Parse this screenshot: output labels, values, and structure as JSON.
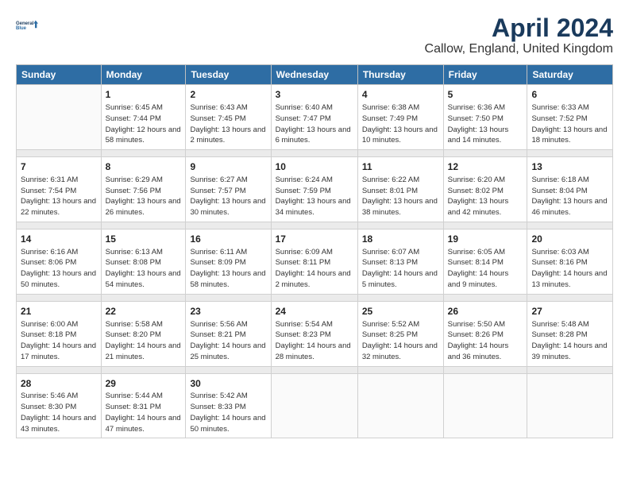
{
  "header": {
    "logo_line1": "General",
    "logo_line2": "Blue",
    "title": "April 2024",
    "subtitle": "Callow, England, United Kingdom"
  },
  "calendar": {
    "days": [
      "Sunday",
      "Monday",
      "Tuesday",
      "Wednesday",
      "Thursday",
      "Friday",
      "Saturday"
    ],
    "weeks": [
      [
        {
          "day": "",
          "sunrise": "",
          "sunset": "",
          "daylight": ""
        },
        {
          "day": "1",
          "sunrise": "Sunrise: 6:45 AM",
          "sunset": "Sunset: 7:44 PM",
          "daylight": "Daylight: 12 hours and 58 minutes."
        },
        {
          "day": "2",
          "sunrise": "Sunrise: 6:43 AM",
          "sunset": "Sunset: 7:45 PM",
          "daylight": "Daylight: 13 hours and 2 minutes."
        },
        {
          "day": "3",
          "sunrise": "Sunrise: 6:40 AM",
          "sunset": "Sunset: 7:47 PM",
          "daylight": "Daylight: 13 hours and 6 minutes."
        },
        {
          "day": "4",
          "sunrise": "Sunrise: 6:38 AM",
          "sunset": "Sunset: 7:49 PM",
          "daylight": "Daylight: 13 hours and 10 minutes."
        },
        {
          "day": "5",
          "sunrise": "Sunrise: 6:36 AM",
          "sunset": "Sunset: 7:50 PM",
          "daylight": "Daylight: 13 hours and 14 minutes."
        },
        {
          "day": "6",
          "sunrise": "Sunrise: 6:33 AM",
          "sunset": "Sunset: 7:52 PM",
          "daylight": "Daylight: 13 hours and 18 minutes."
        }
      ],
      [
        {
          "day": "7",
          "sunrise": "Sunrise: 6:31 AM",
          "sunset": "Sunset: 7:54 PM",
          "daylight": "Daylight: 13 hours and 22 minutes."
        },
        {
          "day": "8",
          "sunrise": "Sunrise: 6:29 AM",
          "sunset": "Sunset: 7:56 PM",
          "daylight": "Daylight: 13 hours and 26 minutes."
        },
        {
          "day": "9",
          "sunrise": "Sunrise: 6:27 AM",
          "sunset": "Sunset: 7:57 PM",
          "daylight": "Daylight: 13 hours and 30 minutes."
        },
        {
          "day": "10",
          "sunrise": "Sunrise: 6:24 AM",
          "sunset": "Sunset: 7:59 PM",
          "daylight": "Daylight: 13 hours and 34 minutes."
        },
        {
          "day": "11",
          "sunrise": "Sunrise: 6:22 AM",
          "sunset": "Sunset: 8:01 PM",
          "daylight": "Daylight: 13 hours and 38 minutes."
        },
        {
          "day": "12",
          "sunrise": "Sunrise: 6:20 AM",
          "sunset": "Sunset: 8:02 PM",
          "daylight": "Daylight: 13 hours and 42 minutes."
        },
        {
          "day": "13",
          "sunrise": "Sunrise: 6:18 AM",
          "sunset": "Sunset: 8:04 PM",
          "daylight": "Daylight: 13 hours and 46 minutes."
        }
      ],
      [
        {
          "day": "14",
          "sunrise": "Sunrise: 6:16 AM",
          "sunset": "Sunset: 8:06 PM",
          "daylight": "Daylight: 13 hours and 50 minutes."
        },
        {
          "day": "15",
          "sunrise": "Sunrise: 6:13 AM",
          "sunset": "Sunset: 8:08 PM",
          "daylight": "Daylight: 13 hours and 54 minutes."
        },
        {
          "day": "16",
          "sunrise": "Sunrise: 6:11 AM",
          "sunset": "Sunset: 8:09 PM",
          "daylight": "Daylight: 13 hours and 58 minutes."
        },
        {
          "day": "17",
          "sunrise": "Sunrise: 6:09 AM",
          "sunset": "Sunset: 8:11 PM",
          "daylight": "Daylight: 14 hours and 2 minutes."
        },
        {
          "day": "18",
          "sunrise": "Sunrise: 6:07 AM",
          "sunset": "Sunset: 8:13 PM",
          "daylight": "Daylight: 14 hours and 5 minutes."
        },
        {
          "day": "19",
          "sunrise": "Sunrise: 6:05 AM",
          "sunset": "Sunset: 8:14 PM",
          "daylight": "Daylight: 14 hours and 9 minutes."
        },
        {
          "day": "20",
          "sunrise": "Sunrise: 6:03 AM",
          "sunset": "Sunset: 8:16 PM",
          "daylight": "Daylight: 14 hours and 13 minutes."
        }
      ],
      [
        {
          "day": "21",
          "sunrise": "Sunrise: 6:00 AM",
          "sunset": "Sunset: 8:18 PM",
          "daylight": "Daylight: 14 hours and 17 minutes."
        },
        {
          "day": "22",
          "sunrise": "Sunrise: 5:58 AM",
          "sunset": "Sunset: 8:20 PM",
          "daylight": "Daylight: 14 hours and 21 minutes."
        },
        {
          "day": "23",
          "sunrise": "Sunrise: 5:56 AM",
          "sunset": "Sunset: 8:21 PM",
          "daylight": "Daylight: 14 hours and 25 minutes."
        },
        {
          "day": "24",
          "sunrise": "Sunrise: 5:54 AM",
          "sunset": "Sunset: 8:23 PM",
          "daylight": "Daylight: 14 hours and 28 minutes."
        },
        {
          "day": "25",
          "sunrise": "Sunrise: 5:52 AM",
          "sunset": "Sunset: 8:25 PM",
          "daylight": "Daylight: 14 hours and 32 minutes."
        },
        {
          "day": "26",
          "sunrise": "Sunrise: 5:50 AM",
          "sunset": "Sunset: 8:26 PM",
          "daylight": "Daylight: 14 hours and 36 minutes."
        },
        {
          "day": "27",
          "sunrise": "Sunrise: 5:48 AM",
          "sunset": "Sunset: 8:28 PM",
          "daylight": "Daylight: 14 hours and 39 minutes."
        }
      ],
      [
        {
          "day": "28",
          "sunrise": "Sunrise: 5:46 AM",
          "sunset": "Sunset: 8:30 PM",
          "daylight": "Daylight: 14 hours and 43 minutes."
        },
        {
          "day": "29",
          "sunrise": "Sunrise: 5:44 AM",
          "sunset": "Sunset: 8:31 PM",
          "daylight": "Daylight: 14 hours and 47 minutes."
        },
        {
          "day": "30",
          "sunrise": "Sunrise: 5:42 AM",
          "sunset": "Sunset: 8:33 PM",
          "daylight": "Daylight: 14 hours and 50 minutes."
        },
        {
          "day": "",
          "sunrise": "",
          "sunset": "",
          "daylight": ""
        },
        {
          "day": "",
          "sunrise": "",
          "sunset": "",
          "daylight": ""
        },
        {
          "day": "",
          "sunrise": "",
          "sunset": "",
          "daylight": ""
        },
        {
          "day": "",
          "sunrise": "",
          "sunset": "",
          "daylight": ""
        }
      ]
    ]
  }
}
